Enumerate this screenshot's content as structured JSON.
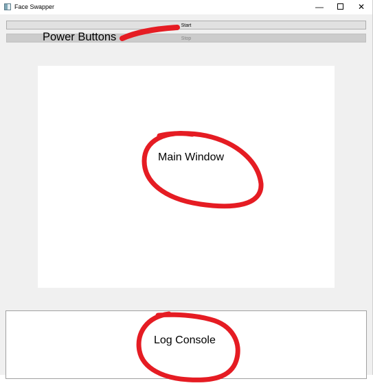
{
  "window": {
    "title": "Face Swapper",
    "icon": "app-window-icon",
    "controls": {
      "minimize_icon": "minimize-icon",
      "maximize_icon": "maximize-icon",
      "close_icon": "close-icon",
      "minimize_glyph": "—",
      "close_glyph": "✕"
    }
  },
  "toolbar": {
    "start_label": "Start",
    "stop_label": "Stop",
    "stop_enabled": false
  },
  "main_view": {
    "background": "#ffffff"
  },
  "log_console": {
    "text": ""
  },
  "annotations": {
    "color": "#e51c23",
    "power_buttons": "Power Buttons",
    "main_window": "Main Window",
    "log_console": "Log Console"
  }
}
